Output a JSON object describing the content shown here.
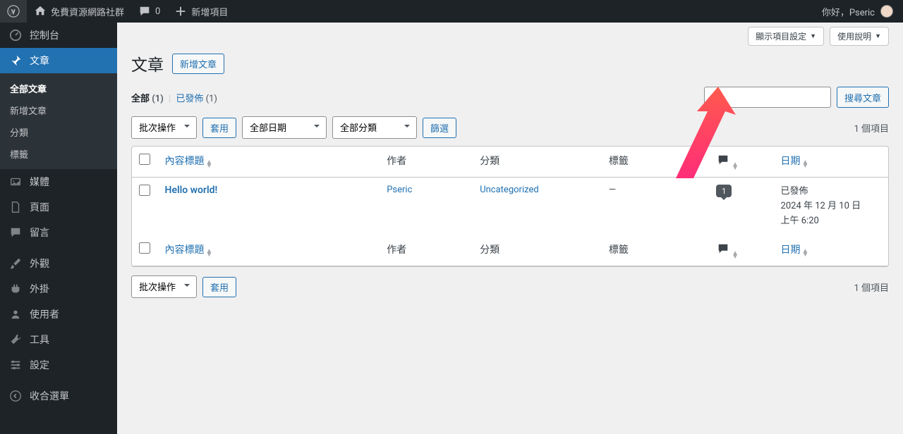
{
  "admin_bar": {
    "site_name": "免費資源網路社群",
    "comments_count": "0",
    "new_item": "新增項目",
    "greeting": "你好，Pseric"
  },
  "sidebar": {
    "dashboard": "控制台",
    "posts": "文章",
    "posts_sub": {
      "all": "全部文章",
      "new": "新增文章",
      "categories": "分類",
      "tags": "標籤"
    },
    "media": "媒體",
    "pages": "頁面",
    "comments": "留言",
    "appearance": "外觀",
    "plugins": "外掛",
    "users": "使用者",
    "tools": "工具",
    "settings": "設定",
    "collapse": "收合選單"
  },
  "screen_options": "顯示項目設定",
  "help": "使用說明",
  "page_title": "文章",
  "add_new": "新增文章",
  "status_filters": {
    "all": "全部",
    "all_count": "(1)",
    "published": "已發佈",
    "published_count": "(1)"
  },
  "search_button": "搜尋文章",
  "bulk_action": "批次操作",
  "apply": "套用",
  "all_dates": "全部日期",
  "all_categories": "全部分類",
  "filter": "篩選",
  "item_count": "1 個項目",
  "columns": {
    "title": "內容標題",
    "author": "作者",
    "categories": "分類",
    "tags": "標籤",
    "date": "日期"
  },
  "rows": [
    {
      "title": "Hello world!",
      "author": "Pseric",
      "category": "Uncategorized",
      "tag": "—",
      "comments": "1",
      "status": "已發佈",
      "date_line1": "2024 年 12 月 10 日",
      "date_line2": "上午 6:20"
    }
  ]
}
